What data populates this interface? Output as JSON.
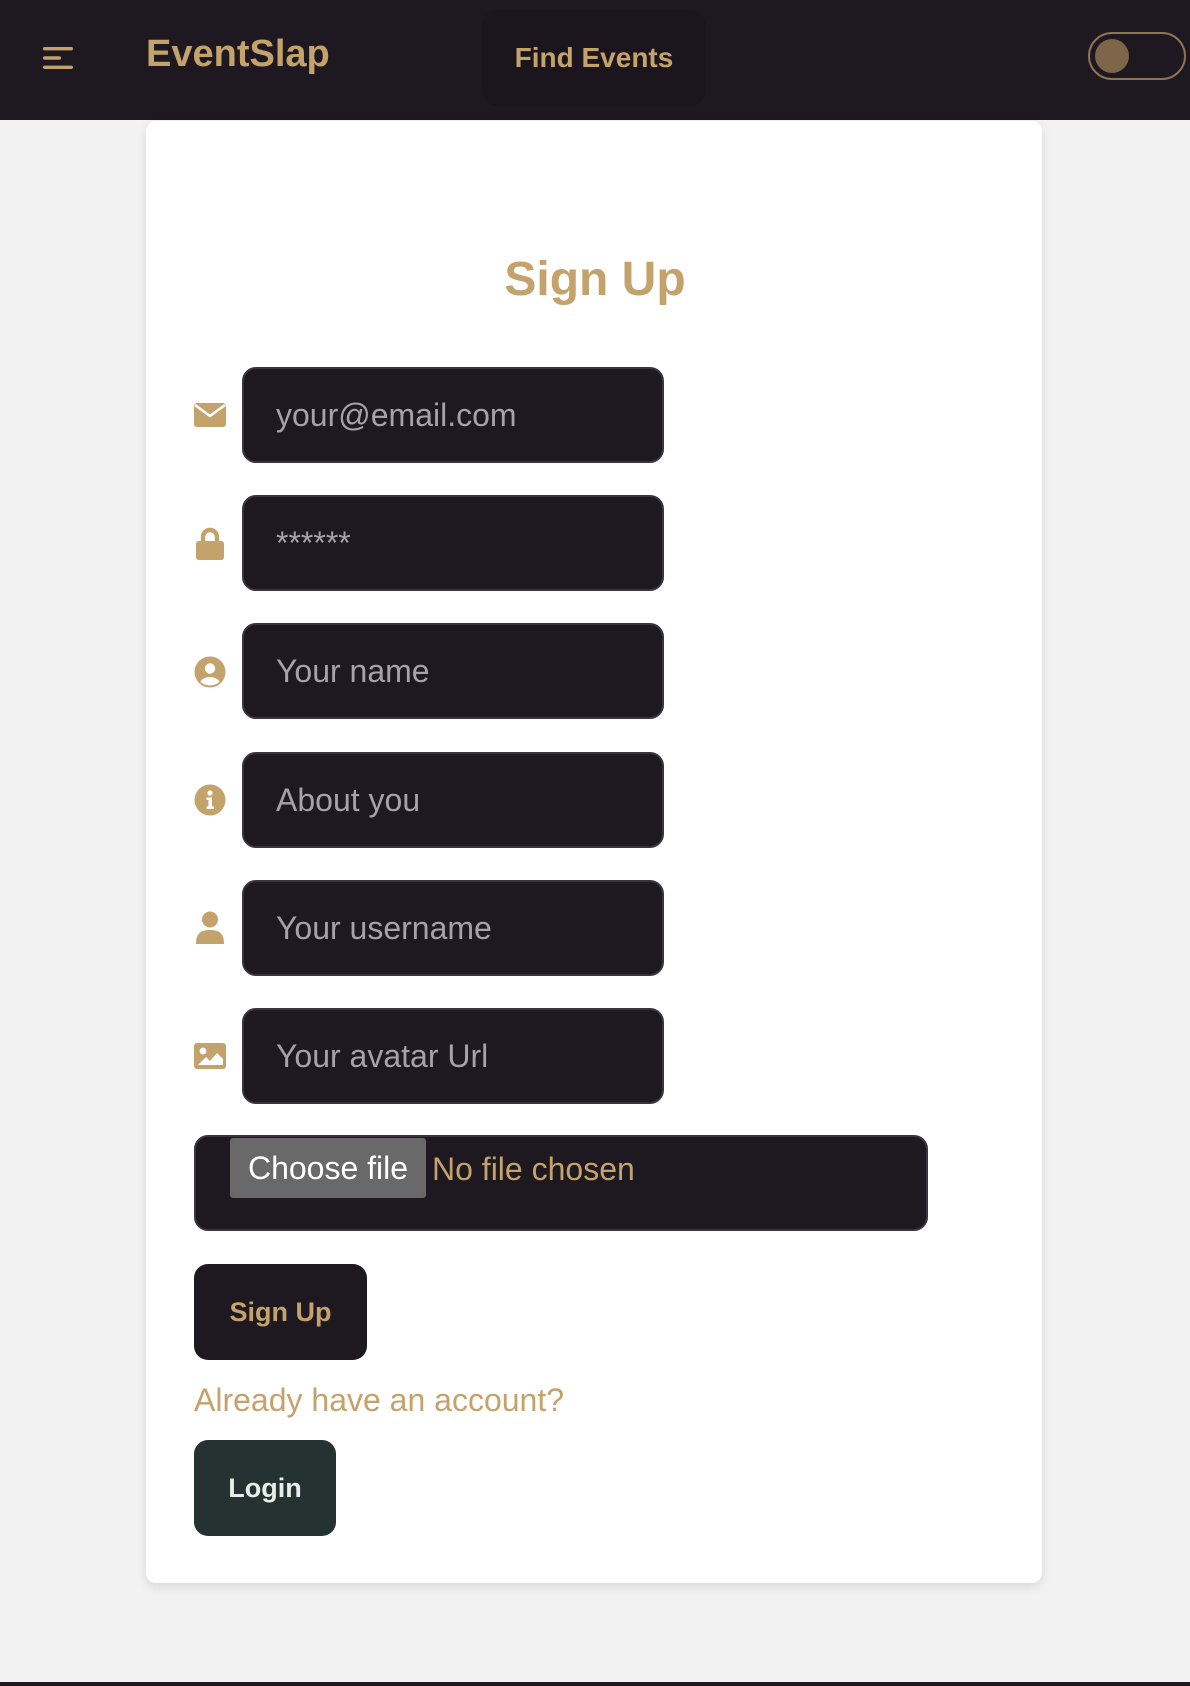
{
  "navbar": {
    "menu_icon": "hamburger-menu-icon",
    "brand": "EventSlap",
    "find_events": "Find Events",
    "theme_toggle": {
      "state": "off"
    }
  },
  "form": {
    "title": "Sign Up",
    "fields": [
      {
        "icon": "envelope-icon",
        "placeholder": "your@email.com"
      },
      {
        "icon": "lock-icon",
        "placeholder": "******"
      },
      {
        "icon": "user-circle-icon",
        "placeholder": "Your name"
      },
      {
        "icon": "info-icon",
        "placeholder": "About you"
      },
      {
        "icon": "user-icon",
        "placeholder": "Your username"
      },
      {
        "icon": "image-icon",
        "placeholder": "Your avatar Url"
      }
    ],
    "file": {
      "button": "Choose file",
      "status": "No file chosen"
    },
    "signup_button": "Sign Up",
    "account_link": "Already have an account?",
    "login_button": "Login"
  },
  "colors": {
    "accent": "#c4a26c",
    "dark": "#1e1820",
    "login": "#243232",
    "background": "#f2f2f2"
  }
}
